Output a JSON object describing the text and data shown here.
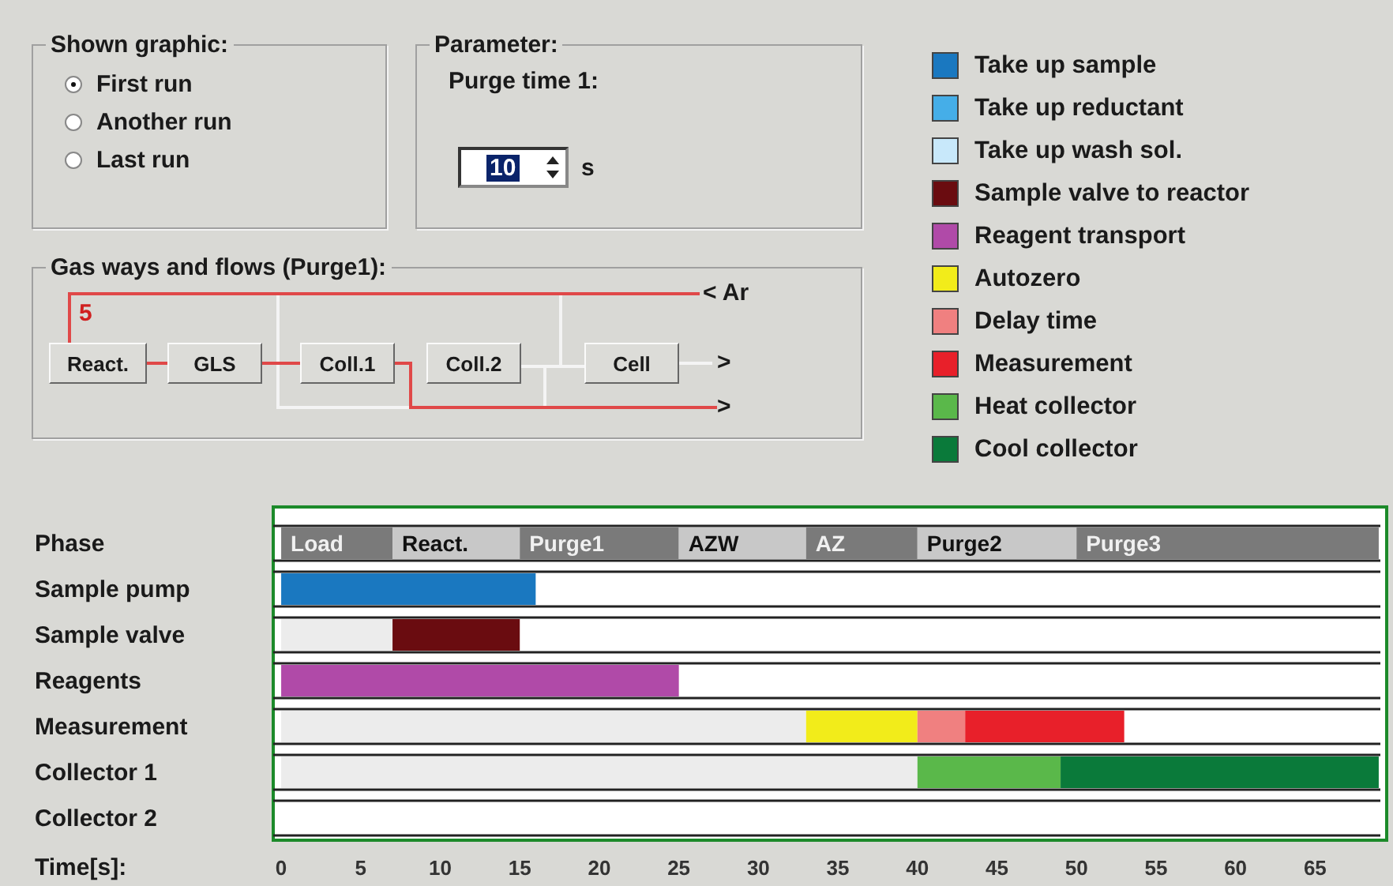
{
  "shown_graphic": {
    "title": "Shown graphic:",
    "options": [
      {
        "label": "First run",
        "selected": true
      },
      {
        "label": "Another run",
        "selected": false
      },
      {
        "label": "Last run",
        "selected": false
      }
    ]
  },
  "parameter": {
    "title": "Parameter:",
    "label": "Purge time 1:",
    "value": "10",
    "unit": "s"
  },
  "gas_flow": {
    "title": "Gas ways and flows (Purge1):",
    "count": "5",
    "argon_inlet": "< Ar",
    "outlets": [
      ">",
      ">"
    ],
    "nodes": [
      "React.",
      "GLS",
      "Coll.1",
      "Coll.2",
      "Cell"
    ]
  },
  "legend": [
    {
      "label": "Take up sample",
      "color": "#1a78c0"
    },
    {
      "label": "Take up reductant",
      "color": "#45aee8"
    },
    {
      "label": "Take up wash sol.",
      "color": "#c8e8fa"
    },
    {
      "label": "Sample valve to reactor",
      "color": "#6a0c10"
    },
    {
      "label": "Reagent transport",
      "color": "#b04aa8"
    },
    {
      "label": "Autozero",
      "color": "#f2ec1a"
    },
    {
      "label": "Delay time",
      "color": "#f08080"
    },
    {
      "label": "Measurement",
      "color": "#e8202a"
    },
    {
      "label": "Heat collector",
      "color": "#5ab84a"
    },
    {
      "label": "Cool collector",
      "color": "#0a7a3a"
    }
  ],
  "timeline": {
    "chart_data": {
      "type": "bar",
      "orientation": "horizontal",
      "stacked": true,
      "xlabel": "Time[s]:",
      "xlim": [
        -0.5,
        69.5
      ],
      "xticks": [
        0,
        5,
        10,
        15,
        20,
        25,
        30,
        35,
        40,
        45,
        50,
        55,
        60,
        65
      ],
      "categories": [
        "Phase",
        "Sample pump",
        "Sample valve",
        "Reagents",
        "Measurement",
        "Collector 1",
        "Collector 2"
      ],
      "series": [
        {
          "color": "#ececec",
          "values": [
            null,
            null,
            7,
            null,
            33,
            40,
            null
          ]
        },
        {
          "name": "Load",
          "color": "#7a7a7a",
          "values": [
            7,
            null,
            null,
            null,
            null,
            null,
            null
          ]
        },
        {
          "name": "React.",
          "color": "#c8c8c8",
          "values": [
            8,
            null,
            null,
            null,
            null,
            null,
            null
          ]
        },
        {
          "name": "Purge1",
          "color": "#7a7a7a",
          "values": [
            10,
            null,
            null,
            null,
            null,
            null,
            null
          ]
        },
        {
          "name": "AZW",
          "color": "#c8c8c8",
          "values": [
            8,
            null,
            null,
            null,
            null,
            null,
            null
          ]
        },
        {
          "name": "AZ",
          "color": "#7a7a7a",
          "values": [
            7,
            null,
            null,
            null,
            null,
            null,
            null
          ]
        },
        {
          "name": "Purge2",
          "color": "#c8c8c8",
          "values": [
            10,
            null,
            null,
            null,
            null,
            null,
            null
          ]
        },
        {
          "name": "Purge3",
          "color": "#7a7a7a",
          "values": [
            19,
            null,
            null,
            null,
            null,
            null,
            null
          ]
        },
        {
          "color": "#1a78c0",
          "values": [
            null,
            16,
            null,
            null,
            null,
            null,
            null
          ]
        },
        {
          "color": "#6a0c10",
          "values": [
            null,
            null,
            8,
            null,
            null,
            null,
            null
          ]
        },
        {
          "color": "#b04aa8",
          "values": [
            null,
            null,
            null,
            25,
            null,
            null,
            null
          ]
        },
        {
          "color": "#f2ec1a",
          "values": [
            null,
            null,
            null,
            null,
            7,
            null,
            null
          ]
        },
        {
          "color": "#f08080",
          "values": [
            null,
            null,
            null,
            null,
            3,
            null,
            null
          ]
        },
        {
          "color": "#e8202a",
          "values": [
            null,
            null,
            null,
            null,
            10,
            null,
            null
          ]
        },
        {
          "color": "#5ab84a",
          "values": [
            null,
            null,
            null,
            null,
            null,
            9,
            null
          ]
        },
        {
          "color": "#0a7a3a",
          "values": [
            null,
            null,
            null,
            null,
            null,
            20,
            null
          ]
        }
      ]
    }
  }
}
